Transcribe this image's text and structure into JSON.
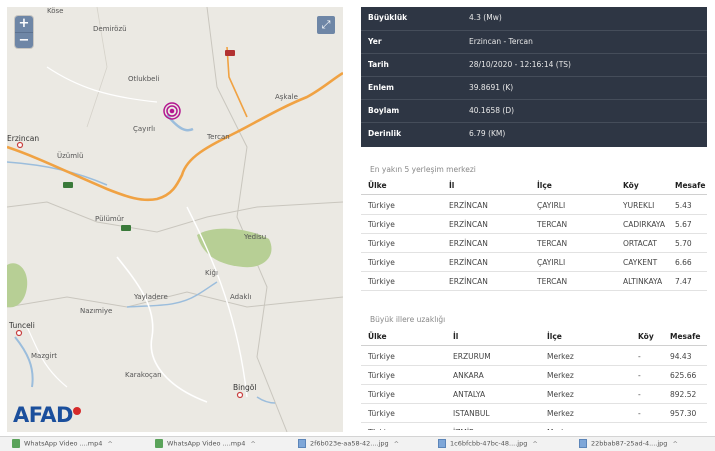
{
  "map": {
    "zoom_in": "+",
    "zoom_out": "−",
    "fullscreen_icon": "⤢",
    "logo": "AFAD",
    "labels": {
      "kose": "Köse",
      "demirozu": "Demirözü",
      "otlukbeli": "Otlukbeli",
      "cayirli": "Çayırlı",
      "askale": "Aşkale",
      "tercan": "Tercan",
      "erzincan": "Erzincan",
      "uzumlu": "Üzümlü",
      "pulumur": "Pülümür",
      "yedisu": "Yedisu",
      "kigi": "Kiğı",
      "yayladere": "Yayladere",
      "adakli": "Adaklı",
      "nazimiye": "Nazımiye",
      "tunceli": "Tunceli",
      "mazgirt": "Mazgirt",
      "karakocan": "Karakoçan",
      "bingol": "Bingöl"
    },
    "colors": {
      "epicenter": "#b3168f",
      "road": "#f0a243",
      "water": "#9bbddc",
      "forest": "#b7cf95"
    }
  },
  "info": {
    "rows": [
      {
        "key": "Büyüklük",
        "value": "4.3 (Mw)"
      },
      {
        "key": "Yer",
        "value": "Erzincan - Tercan"
      },
      {
        "key": "Tarih",
        "value": "28/10/2020 - 12:16:14 (TS)"
      },
      {
        "key": "Enlem",
        "value": "39.8691 (K)"
      },
      {
        "key": "Boylam",
        "value": "40.1658 (D)"
      },
      {
        "key": "Derinlik",
        "value": "6.79 (KM)"
      }
    ]
  },
  "nearest": {
    "title": "En yakın 5 yerleşim merkezi",
    "headers": [
      "Ülke",
      "İl",
      "İlçe",
      "Köy",
      "Mesafe"
    ],
    "rows": [
      [
        "Türkiye",
        "ERZİNCAN",
        "ÇAYIRLI",
        "YUREKLI",
        "5.43"
      ],
      [
        "Türkiye",
        "ERZİNCAN",
        "TERCAN",
        "CADIRKAYA",
        "5.67"
      ],
      [
        "Türkiye",
        "ERZİNCAN",
        "TERCAN",
        "ORTACAT",
        "5.70"
      ],
      [
        "Türkiye",
        "ERZİNCAN",
        "ÇAYIRLI",
        "CAYKENT",
        "6.66"
      ],
      [
        "Türkiye",
        "ERZİNCAN",
        "TERCAN",
        "ALTINKAYA",
        "7.47"
      ]
    ]
  },
  "big_cities": {
    "title": "Büyük illere uzaklığı",
    "headers": [
      "Ülke",
      "İl",
      "İlçe",
      "Köy",
      "Mesafe"
    ],
    "rows": [
      [
        "Türkiye",
        "ERZURUM",
        "Merkez",
        "-",
        "94.43"
      ],
      [
        "Türkiye",
        "ANKARA",
        "Merkez",
        "-",
        "625.66"
      ],
      [
        "Türkiye",
        "ANTALYA",
        "Merkez",
        "-",
        "892.52"
      ],
      [
        "Türkiye",
        "ISTANBUL",
        "Merkez",
        "-",
        "957.30"
      ],
      [
        "Türkiye",
        "İZMİR",
        "Merkez",
        "",
        ""
      ]
    ]
  },
  "taskbar": {
    "items": [
      {
        "label": "WhatsApp Video ....mp4",
        "icon": "video-file-icon"
      },
      {
        "label": "WhatsApp Video ....mp4",
        "icon": "video-file-icon"
      },
      {
        "label": "2f6b023e-aa58-42....jpg",
        "icon": "image-file-icon"
      },
      {
        "label": "1c6bfcbb-47bc-48....jpg",
        "icon": "image-file-icon"
      },
      {
        "label": "22bbab87-25ad-4....jpg",
        "icon": "image-file-icon"
      }
    ],
    "chevron": "^"
  }
}
